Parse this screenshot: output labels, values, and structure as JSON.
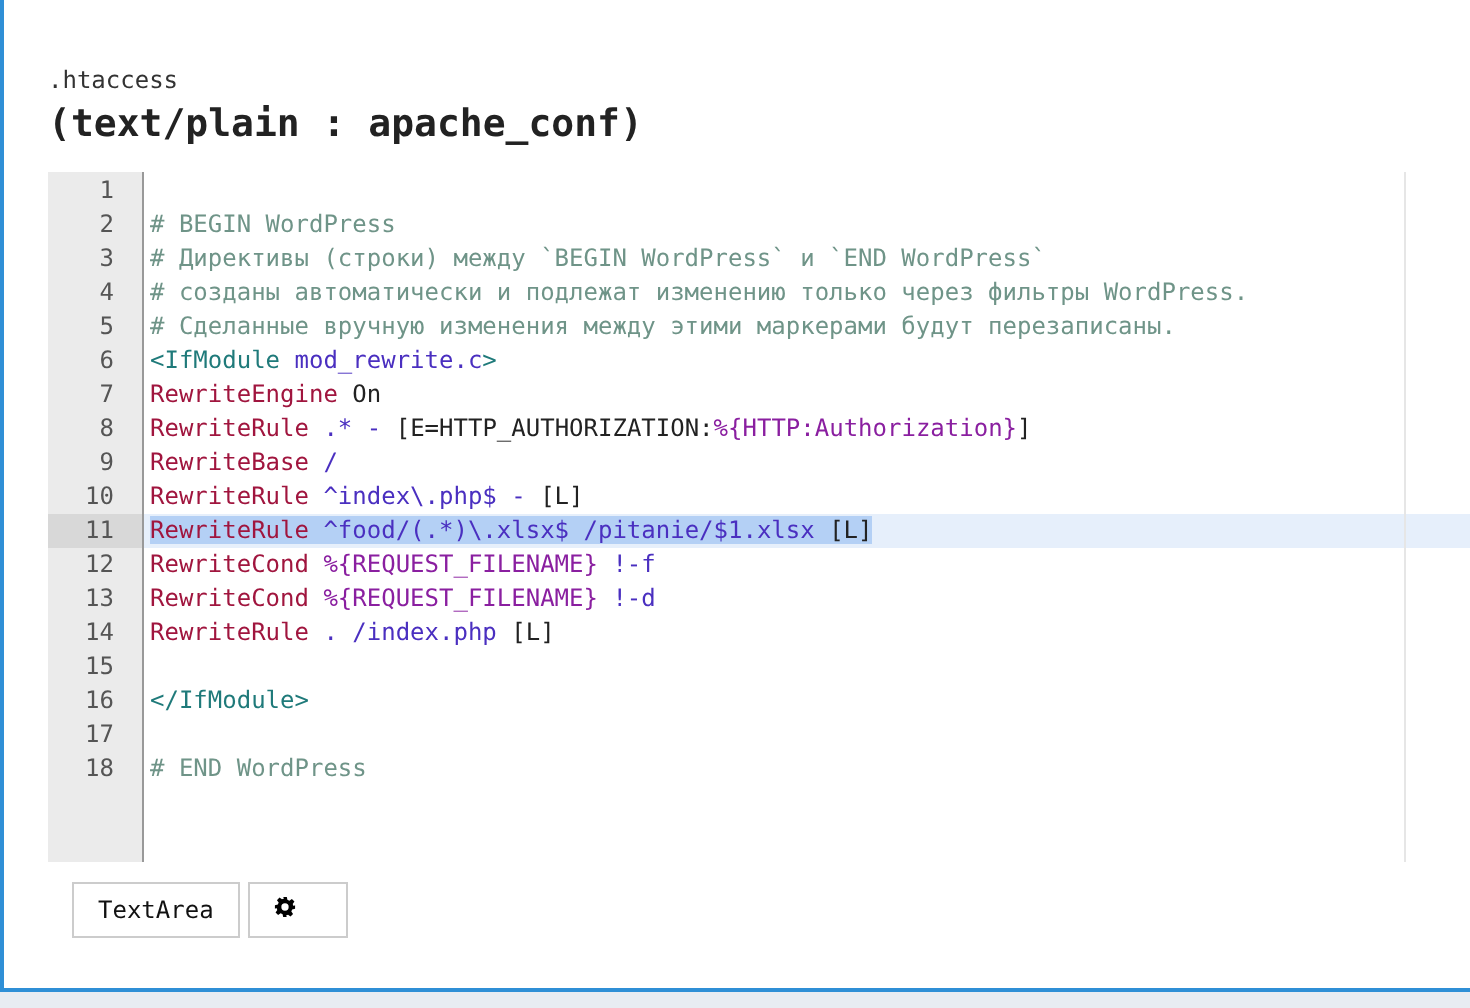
{
  "file": {
    "name": ".htaccess",
    "type": "(text/plain : apache_conf)"
  },
  "editor": {
    "lines": [
      {
        "number": "1",
        "selected": false
      },
      {
        "number": "2",
        "selected": false,
        "tokens": [
          {
            "kind": "comment",
            "text": "# BEGIN WordPress"
          }
        ]
      },
      {
        "number": "3",
        "selected": false,
        "tokens": [
          {
            "kind": "comment",
            "text": "# Директивы (строки) между `BEGIN WordPress` и `END WordPress`"
          }
        ]
      },
      {
        "number": "4",
        "selected": false,
        "tokens": [
          {
            "kind": "comment",
            "text": "# созданы автоматически и подлежат изменению только через фильтры WordPress."
          }
        ]
      },
      {
        "number": "5",
        "selected": false,
        "tokens": [
          {
            "kind": "comment",
            "text": "# Сделанные вручную изменения между этими маркерами будут перезаписаны."
          }
        ]
      },
      {
        "number": "6",
        "selected": false,
        "tokens": [
          {
            "kind": "tag",
            "text": "<IfModule "
          },
          {
            "kind": "value",
            "text": "mod_rewrite.c"
          },
          {
            "kind": "tag",
            "text": ">"
          }
        ]
      },
      {
        "number": "7",
        "selected": false,
        "tokens": [
          {
            "kind": "directive",
            "text": "RewriteEngine"
          },
          {
            "kind": "text",
            "text": " On"
          }
        ]
      },
      {
        "number": "8",
        "selected": false,
        "tokens": [
          {
            "kind": "directive",
            "text": "RewriteRule"
          },
          {
            "kind": "value",
            "text": " .* - "
          },
          {
            "kind": "text",
            "text": "[E=HTTP_AUTHORIZATION:"
          },
          {
            "kind": "variable",
            "text": "%{HTTP:Authorization}"
          },
          {
            "kind": "text",
            "text": "]"
          }
        ]
      },
      {
        "number": "9",
        "selected": false,
        "tokens": [
          {
            "kind": "directive",
            "text": "RewriteBase"
          },
          {
            "kind": "value",
            "text": " /"
          }
        ]
      },
      {
        "number": "10",
        "selected": false,
        "tokens": [
          {
            "kind": "directive",
            "text": "RewriteRule"
          },
          {
            "kind": "value",
            "text": " ^index\\.php$ - "
          },
          {
            "kind": "text",
            "text": "[L]"
          }
        ]
      },
      {
        "number": "11",
        "selected": true,
        "tokens": [
          {
            "kind": "directive",
            "text": "RewriteRule"
          },
          {
            "kind": "value",
            "text": " ^food/(.*)\\.xlsx$ /pitanie/$1.xlsx "
          },
          {
            "kind": "text",
            "text": "[L]"
          }
        ]
      },
      {
        "number": "12",
        "selected": false,
        "tokens": [
          {
            "kind": "directive",
            "text": "RewriteCond "
          },
          {
            "kind": "variable",
            "text": "%{REQUEST_FILENAME}"
          },
          {
            "kind": "value",
            "text": " !-f"
          }
        ]
      },
      {
        "number": "13",
        "selected": false,
        "tokens": [
          {
            "kind": "directive",
            "text": "RewriteCond "
          },
          {
            "kind": "variable",
            "text": "%{REQUEST_FILENAME}"
          },
          {
            "kind": "value",
            "text": " !-d"
          }
        ]
      },
      {
        "number": "14",
        "selected": false,
        "tokens": [
          {
            "kind": "directive",
            "text": "RewriteRule"
          },
          {
            "kind": "value",
            "text": " . /index.php "
          },
          {
            "kind": "text",
            "text": "[L]"
          }
        ]
      },
      {
        "number": "15",
        "selected": false
      },
      {
        "number": "16",
        "selected": false,
        "tokens": [
          {
            "kind": "tag",
            "text": "</IfModule>"
          }
        ]
      },
      {
        "number": "17",
        "selected": false
      },
      {
        "number": "18",
        "selected": false,
        "tokens": [
          {
            "kind": "comment",
            "text": "# END WordPress"
          }
        ]
      }
    ]
  },
  "buttons": [
    {
      "kind": "text",
      "label": "TextArea"
    },
    {
      "kind": "settings"
    }
  ]
}
